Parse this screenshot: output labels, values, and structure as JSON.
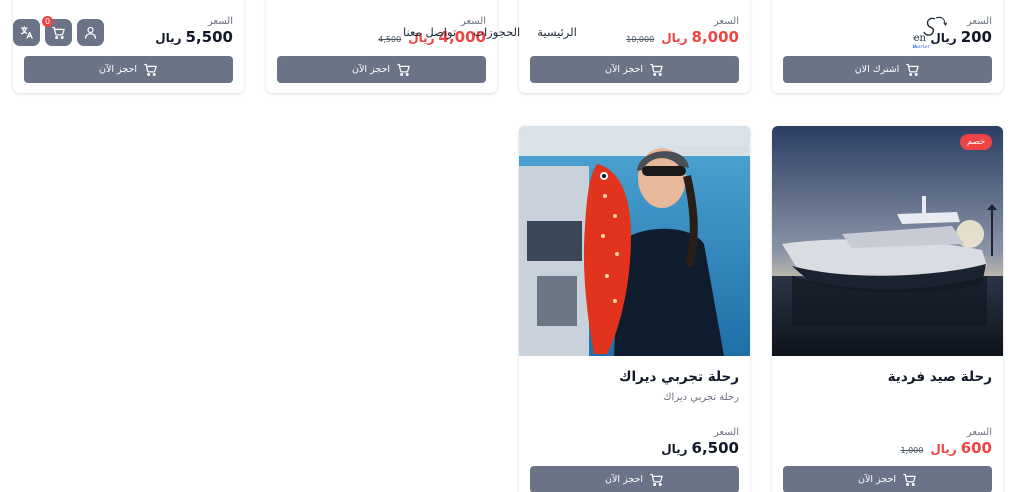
{
  "header": {
    "cart_count": "0",
    "nav": [
      "الرئيسية",
      "الحجوزات",
      "تواصل معنا"
    ],
    "logo_text": "SeVen Seas Charter"
  },
  "currency_symbol": "ريال",
  "price_label": "السعر",
  "top_cards": [
    {
      "price": "200",
      "button": "اشترك الان",
      "sale": false,
      "old_price": ""
    },
    {
      "price": "8,000",
      "old_price": "10,000",
      "button": "احجز الآن",
      "sale": true
    },
    {
      "price": "4,000",
      "old_price": "4,500",
      "button": "احجز الآن",
      "sale": true
    },
    {
      "price": "5,500",
      "button": "احجز الآن",
      "sale": false,
      "old_price": ""
    }
  ],
  "bottom_cards": [
    {
      "title": "رحلة صيد فردية",
      "desc": "",
      "badge": "خصم",
      "price": "600",
      "old_price": "1,000",
      "button": "احجز الآن",
      "sale": true
    },
    {
      "title": "رحلة تجربي ديراك",
      "desc": "رحلة تجربي ديراك",
      "price": "6,500",
      "old_price": "",
      "button": "احجز الآن",
      "sale": false
    }
  ],
  "colors": {
    "button": "#6b7487",
    "sale": "#ef4444"
  }
}
